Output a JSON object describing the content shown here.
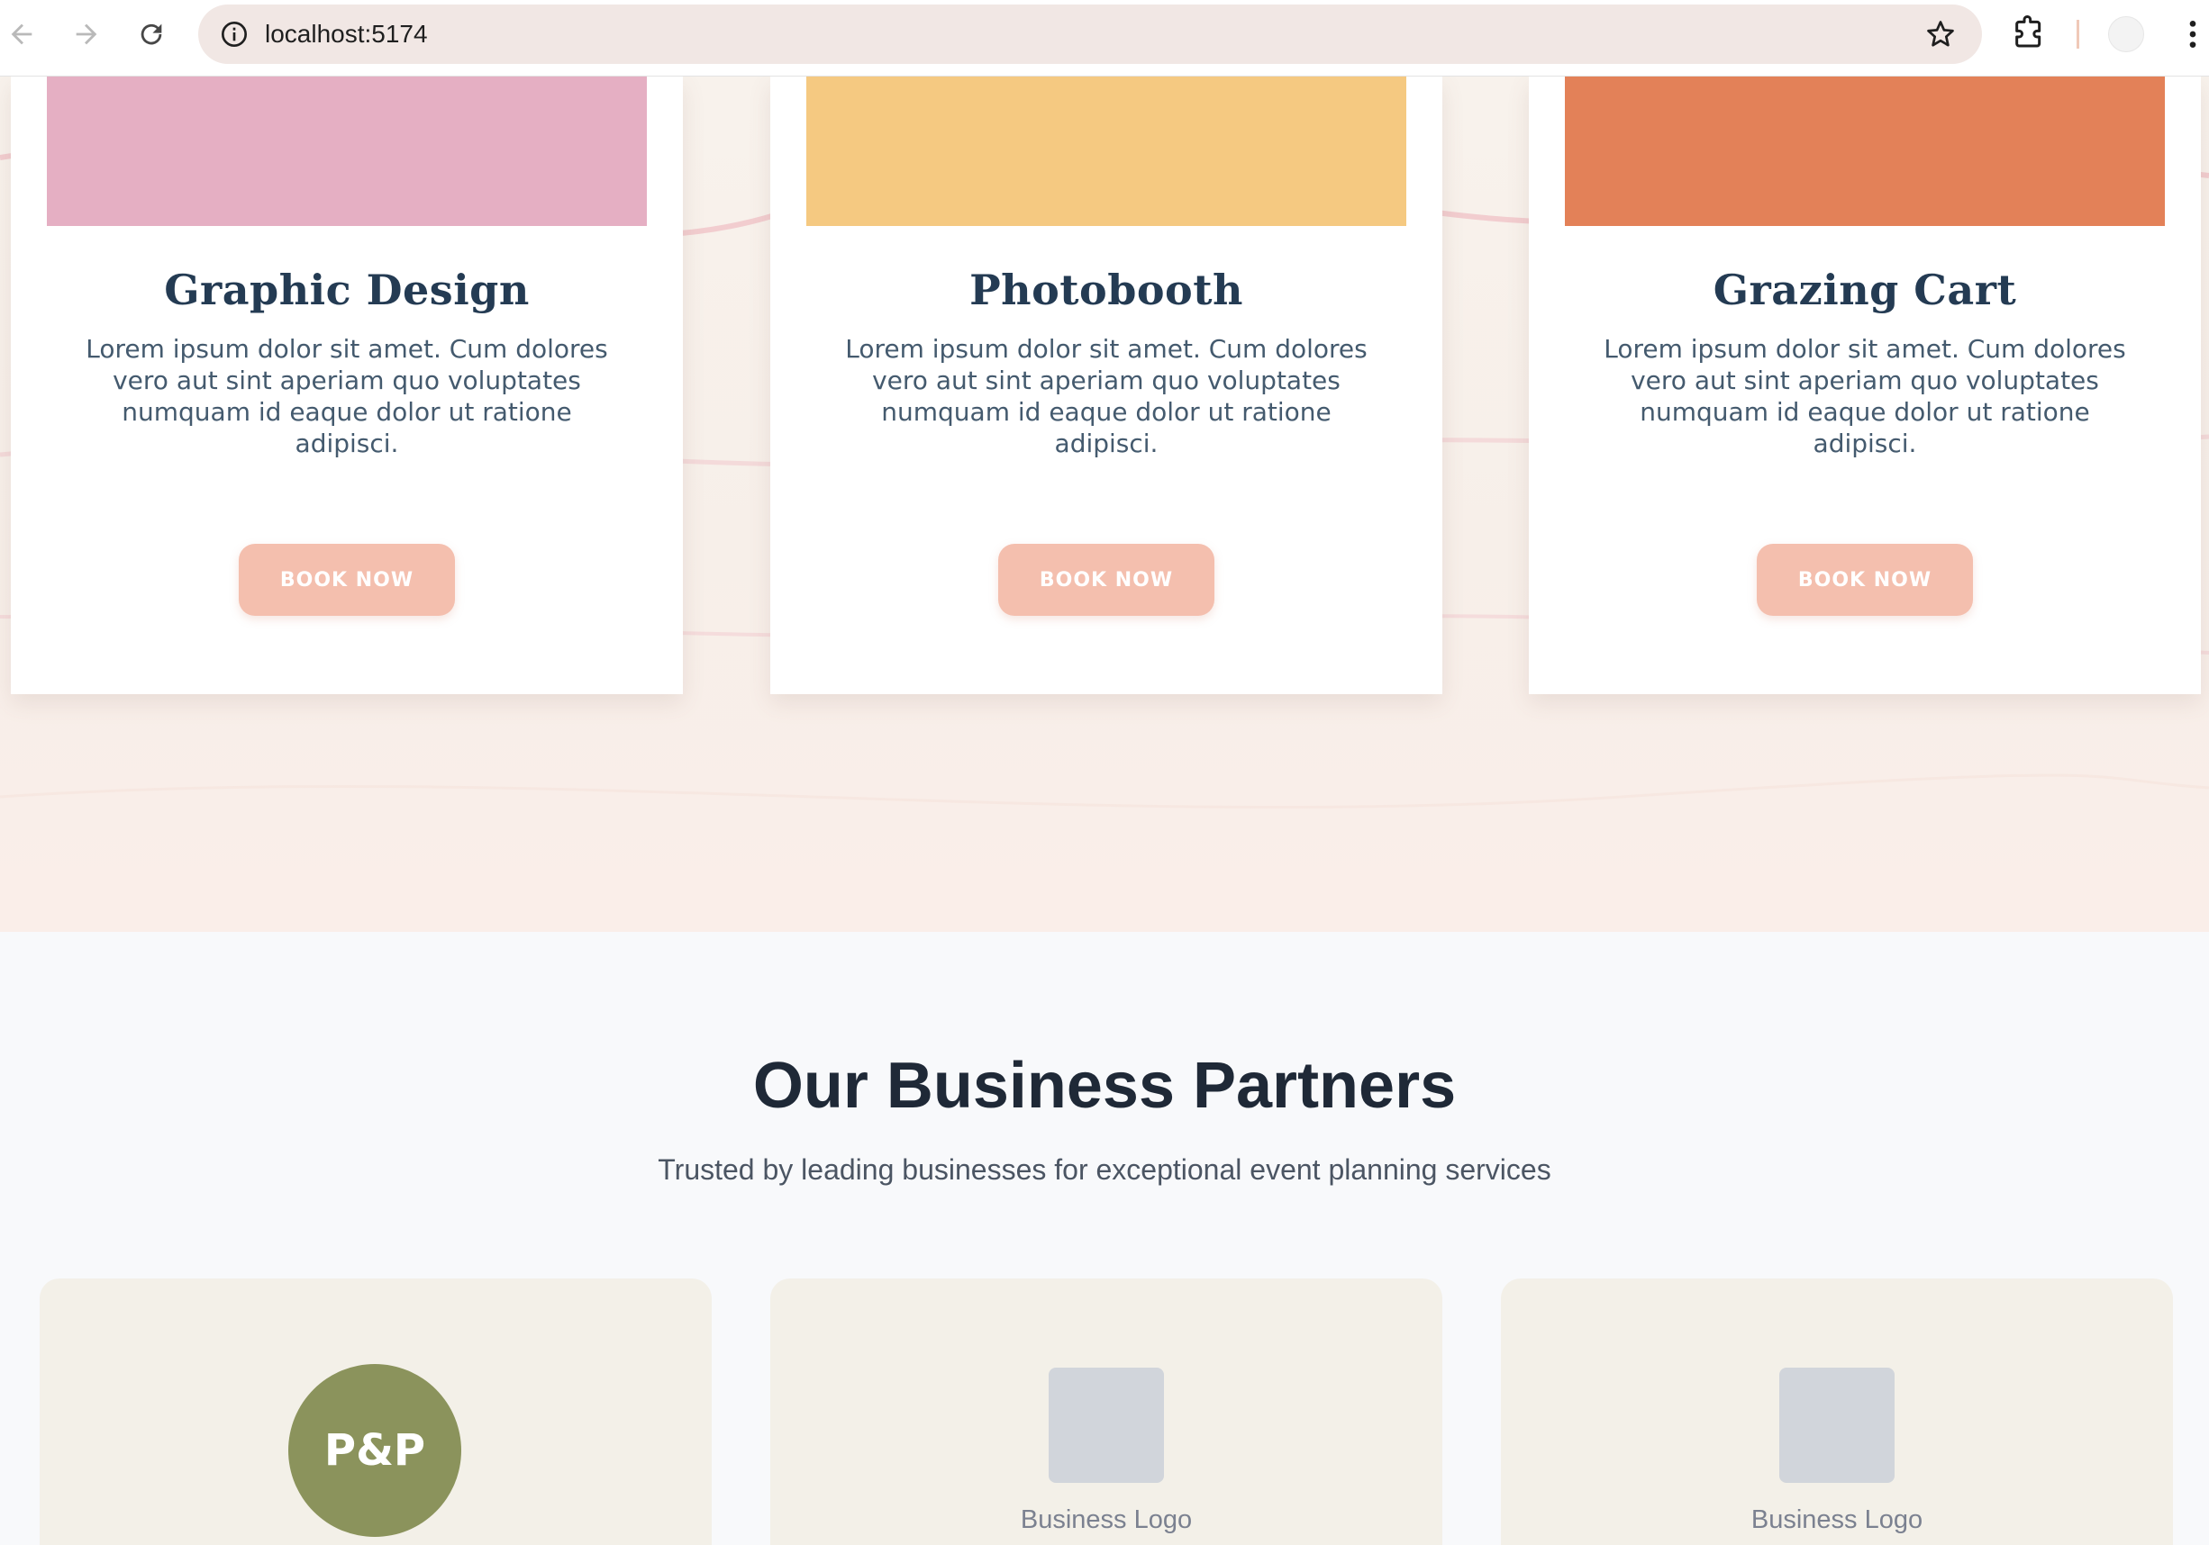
{
  "browser": {
    "url": "localhost:5174",
    "icons": [
      "back-arrow-icon",
      "forward-arrow-icon",
      "reload-icon",
      "info-icon",
      "bookmark-star-icon",
      "extensions-icon",
      "profile-avatar",
      "more-menu-icon"
    ]
  },
  "services": {
    "cards": [
      {
        "title": "Graphic Design",
        "description": "Lorem ipsum dolor sit amet. Cum dolores vero aut sint aperiam quo voluptates numquam id eaque dolor ut ratione adipisci.",
        "button": "BOOK NOW",
        "color": "#e5afc3"
      },
      {
        "title": "Photobooth",
        "description": "Lorem ipsum dolor sit amet. Cum dolores vero aut sint aperiam quo voluptates numquam id eaque dolor ut ratione adipisci.",
        "button": "BOOK NOW",
        "color": "#f5c981"
      },
      {
        "title": "Grazing Cart",
        "description": "Lorem ipsum dolor sit amet. Cum dolores vero aut sint aperiam quo voluptates numquam id eaque dolor ut ratione adipisci.",
        "button": "BOOK NOW",
        "color": "#e38158"
      }
    ]
  },
  "partners": {
    "heading": "Our Business Partners",
    "subheading": "Trusted by leading businesses for exceptional event planning services",
    "cards": [
      {
        "initials": "P&P",
        "badge_color": "#8b935c"
      },
      {
        "label": "Business Logo"
      },
      {
        "label": "Business Logo"
      }
    ]
  },
  "colors": {
    "button": "#f4bfae",
    "title_text": "#243b53",
    "partner_card_bg": "#f3f0e8"
  }
}
